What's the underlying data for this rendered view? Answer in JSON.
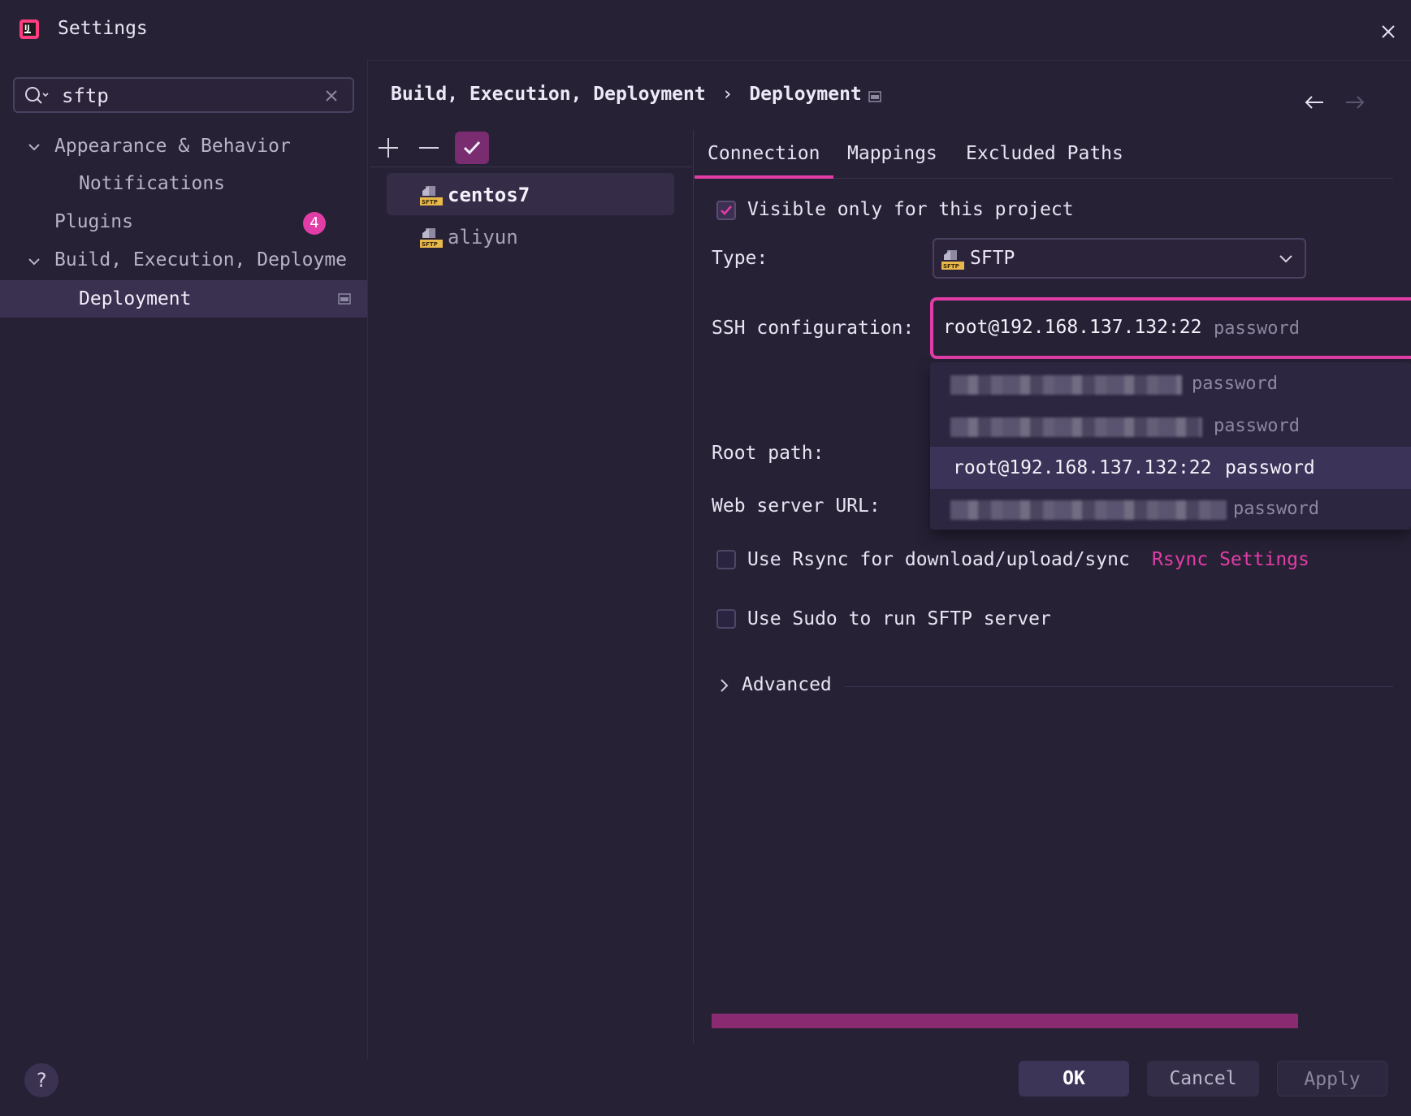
{
  "window": {
    "title": "Settings",
    "logo_icon": "intellij-logo-icon",
    "close_icon": "close-icon"
  },
  "sidebar": {
    "search": {
      "value": "sftp",
      "search_icon": "search-icon",
      "clear_icon": "close-icon"
    },
    "tree": [
      {
        "label": "Appearance & Behavior",
        "expanded": true
      },
      {
        "label": "Notifications"
      },
      {
        "label": "Plugins",
        "badge": "4"
      },
      {
        "label": "Build, Execution, Deployme",
        "expanded": true
      },
      {
        "label": "Deployment",
        "selected": true,
        "pin_icon": "project-settings-icon"
      }
    ]
  },
  "breadcrumb": {
    "parent": "Build, Execution, Deployment",
    "separator": "›",
    "current": "Deployment"
  },
  "servers": {
    "toolbar": {
      "add_icon": "plus-icon",
      "remove_icon": "minus-icon",
      "default_icon": "check-icon"
    },
    "items": [
      {
        "label": "centos7",
        "icon": "sftp-server-icon",
        "selected": true
      },
      {
        "label": "aliyun",
        "icon": "sftp-server-icon"
      }
    ]
  },
  "tabs": [
    {
      "label": "Connection",
      "active": true
    },
    {
      "label": "Mappings"
    },
    {
      "label": "Excluded Paths"
    }
  ],
  "connection": {
    "visible_only": {
      "label": "Visible only for this project",
      "checked": true
    },
    "type": {
      "label": "Type:",
      "value": "SFTP"
    },
    "ssh": {
      "label": "SSH configuration:",
      "value": "root@192.168.137.132:22",
      "auth": "password"
    },
    "ssh_options": [
      {
        "auth": "password",
        "redacted": true
      },
      {
        "auth": "password",
        "redacted": true
      },
      {
        "value": "root@192.168.137.132:22",
        "auth": "password",
        "highlighted": true
      },
      {
        "auth": "password",
        "redacted": true
      }
    ],
    "root_path": {
      "label": "Root path:"
    },
    "web_server_url": {
      "label": "Web server URL:"
    },
    "rsync": {
      "label": "Use Rsync for download/upload/sync",
      "link": "Rsync Settings",
      "checked": false
    },
    "sudo": {
      "label": "Use Sudo to run SFTP server",
      "checked": false
    },
    "advanced": {
      "label": "Advanced"
    }
  },
  "footer": {
    "help": "?",
    "ok": "OK",
    "cancel": "Cancel",
    "apply": "Apply"
  },
  "colors": {
    "accent": "#e23da6",
    "background": "#272136",
    "selection": "#3a3150"
  }
}
